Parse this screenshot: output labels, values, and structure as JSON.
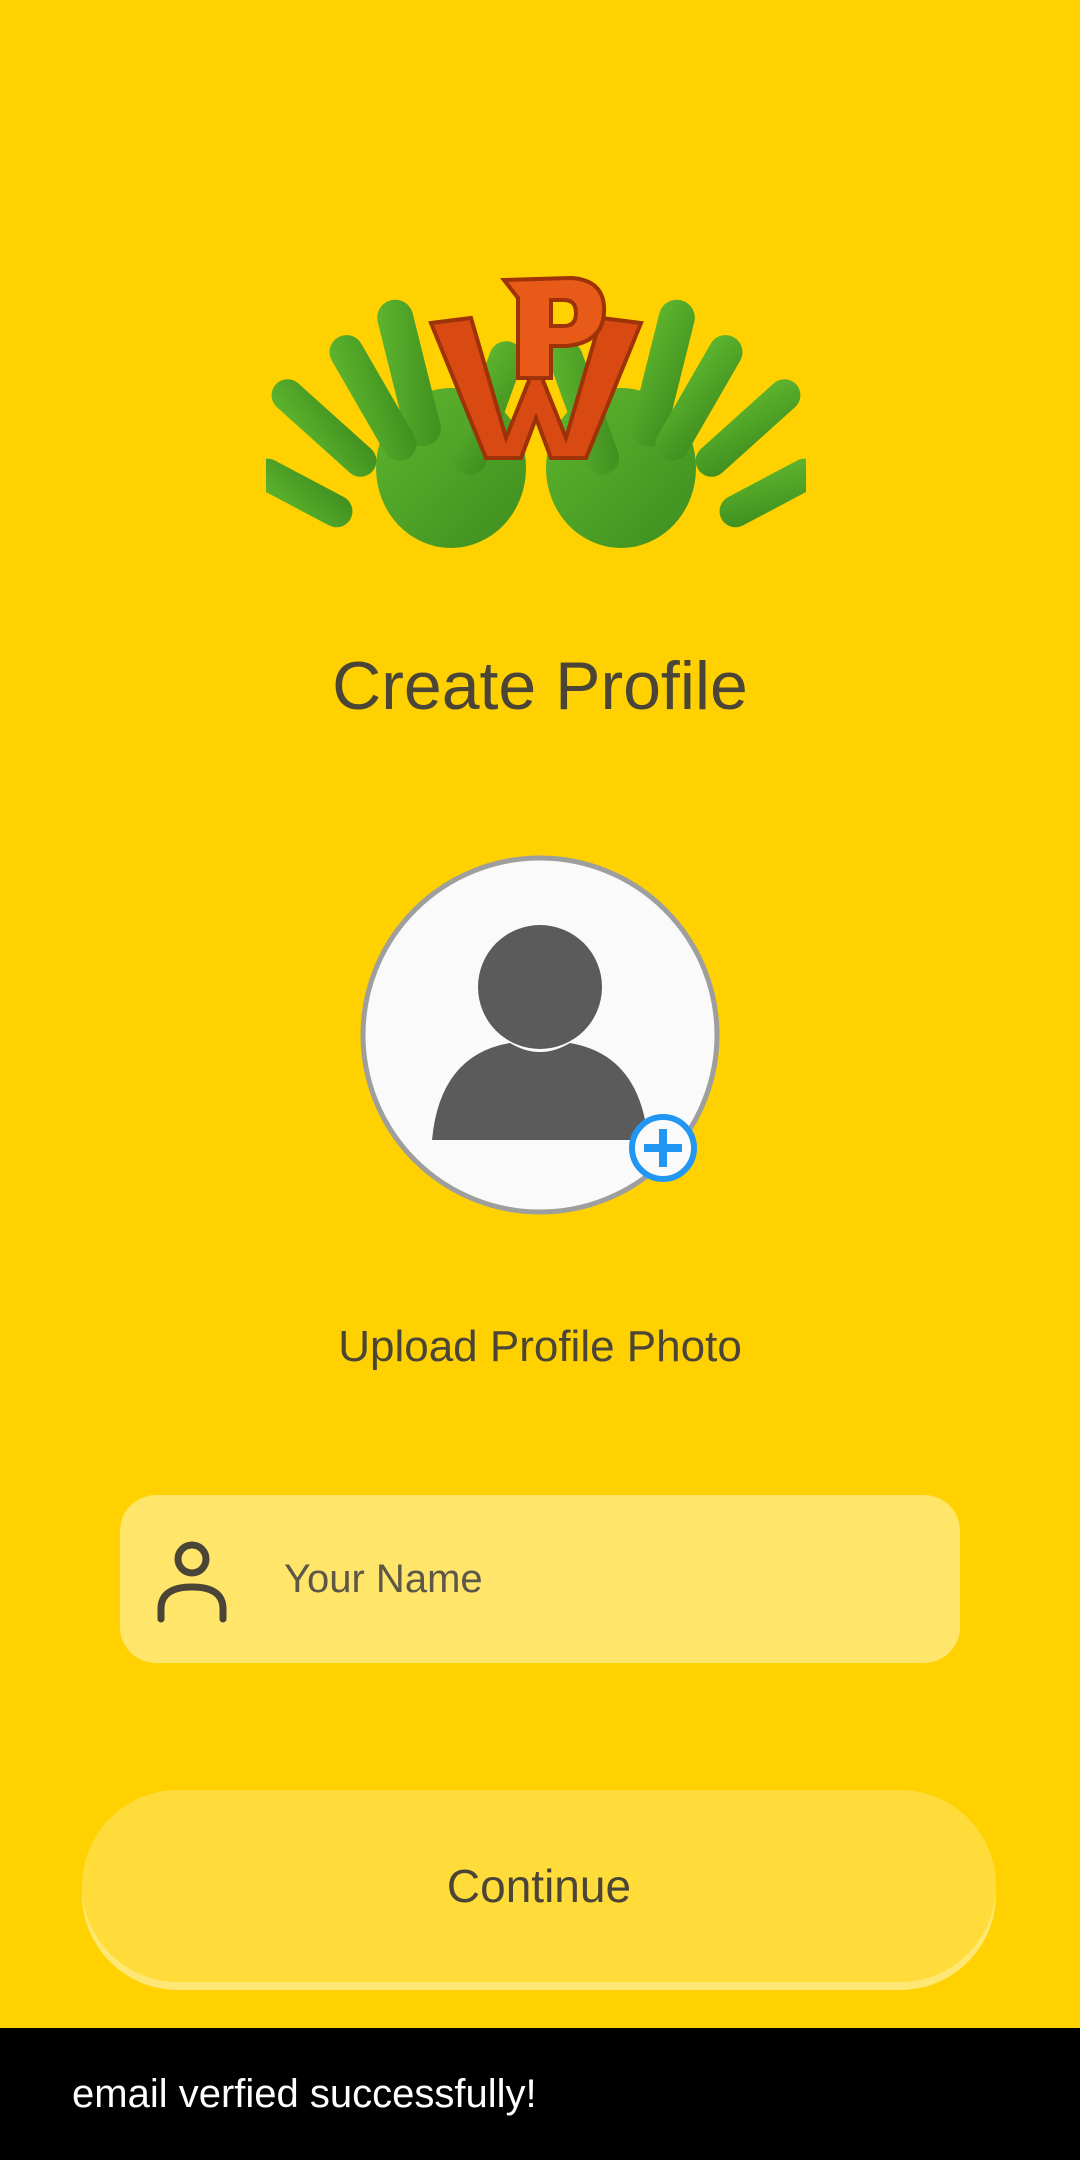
{
  "screen": {
    "title": "Create Profile",
    "logo_icon": "wave-hands-w-logo-icon"
  },
  "profile_photo": {
    "avatar_icon": "person-silhouette-icon",
    "add_icon": "add-circle-icon",
    "upload_label": "Upload Profile Photo"
  },
  "name_field": {
    "icon": "person-outline-icon",
    "placeholder": "Your Name",
    "value": ""
  },
  "continue_button": {
    "label": "Continue"
  },
  "snackbar": {
    "message": "email verfied successfully!"
  },
  "colors": {
    "background": "#FFD100",
    "field_background": "#FFE66B",
    "button_background": "#FFDC3A",
    "text": "#4A4536",
    "accent_add": "#2196F3",
    "snackbar_background": "#000000"
  }
}
